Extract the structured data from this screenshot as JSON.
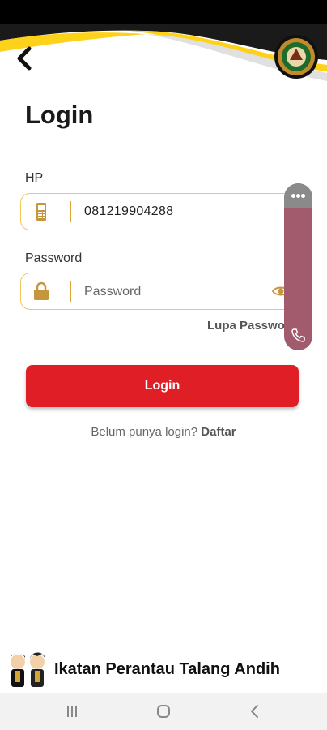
{
  "login": {
    "title": "Login",
    "phone_label": "HP",
    "phone_value": "081219904288",
    "password_label": "Password",
    "password_placeholder": "Password",
    "forgot_label": "Lupa Password",
    "submit_label": "Login",
    "register_prompt": "Belum punya login?",
    "register_link": "Daftar"
  },
  "footer": {
    "org_name": "Ikatan Perantau Talang Andih"
  },
  "colors": {
    "accent": "#e01e26",
    "field_border": "#f1c75a",
    "icon_gold": "#c6963f",
    "header_yellow": "#ffd21a",
    "floating_panel": "#a15b6c"
  },
  "icons": {
    "back": "back-arrow-icon",
    "phone_field": "mobile-phone-icon",
    "password_field": "lock-icon",
    "visibility": "eye-icon",
    "panel_menu": "more-dots-icon",
    "panel_call": "phone-call-icon"
  }
}
